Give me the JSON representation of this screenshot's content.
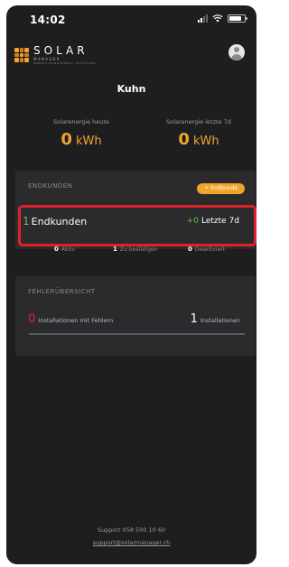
{
  "status_bar": {
    "time": "14:02"
  },
  "logo": {
    "main": "SOLAR",
    "sub": "MANAGER",
    "tagline": "ENERGY MANAGEMENT SOLUTIONS"
  },
  "header": {
    "title": "Kuhn"
  },
  "energy": {
    "today": {
      "label": "Solarenergie heute",
      "value": "0",
      "unit": "kWh"
    },
    "week": {
      "label": "Solarenergie letzte 7d",
      "value": "0",
      "unit": "kWh"
    }
  },
  "customers": {
    "section_label": "ENDKUNDEN",
    "add_button": "+ Endkunde",
    "count": "1",
    "count_label": "Endkunden",
    "week_delta": "+0",
    "week_label": "Letzte 7d",
    "stats": [
      {
        "value": "0",
        "label": "Aktiv"
      },
      {
        "value": "1",
        "label": "Zu bestätigen"
      },
      {
        "value": "0",
        "label": "Deaktiviert"
      }
    ]
  },
  "errors": {
    "section_label": "FEHLERÜBERSICHT",
    "error_count": "0",
    "error_label": "Installationen mit Fehlern",
    "installations_count": "1",
    "installations_label": "Installationen",
    "error_fraction": 0
  },
  "footer": {
    "support_phone": "Support 058 500 10 60",
    "support_email": "support@solarmanager.ch"
  },
  "colors": {
    "accent": "#f0a52a",
    "positive": "#6cc34a",
    "alert": "#e0212c",
    "background": "#1e1e20",
    "card": "#2b2b2e"
  }
}
